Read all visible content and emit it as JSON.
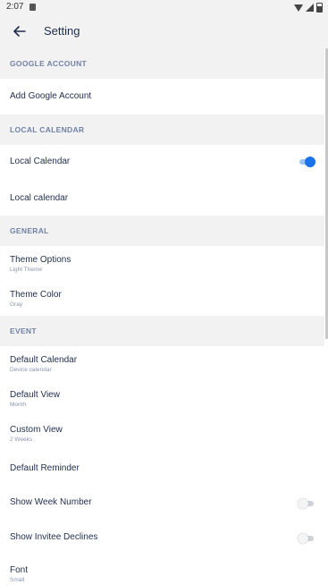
{
  "status_bar": {
    "time": "2:07"
  },
  "toolbar": {
    "title": "Setting"
  },
  "sections": {
    "google_account": {
      "header": "GOOGLE ACCOUNT",
      "add_account": "Add Google Account"
    },
    "local_calendar": {
      "header": "LOCAL CALENDAR",
      "toggle_label": "Local Calendar",
      "toggle_on": true,
      "calendar_item": "Local calendar"
    },
    "general": {
      "header": "GENERAL",
      "theme_options": {
        "title": "Theme Options",
        "value": "Light Theme"
      },
      "theme_color": {
        "title": "Theme Color",
        "value": "Gray"
      }
    },
    "event": {
      "header": "EVENT",
      "default_calendar": {
        "title": "Default Calendar",
        "value": "Device calendar"
      },
      "default_view": {
        "title": "Default View",
        "value": "Month"
      },
      "custom_view": {
        "title": "Custom View",
        "value": "2 Weeks"
      },
      "default_reminder": {
        "title": "Default Reminder"
      },
      "show_week_number": {
        "title": "Show Week Number",
        "enabled": false
      },
      "show_invitee_declines": {
        "title": "Show Invitee Declines",
        "enabled": false
      },
      "font": {
        "title": "Font",
        "value": "Small"
      }
    }
  },
  "colors": {
    "accent": "#1a73e8",
    "section_header_text": "#7182a5",
    "primary_text": "#1f2d4d",
    "background_gray": "#f2f2f2"
  },
  "icons": {
    "back": "arrow-left-icon"
  }
}
